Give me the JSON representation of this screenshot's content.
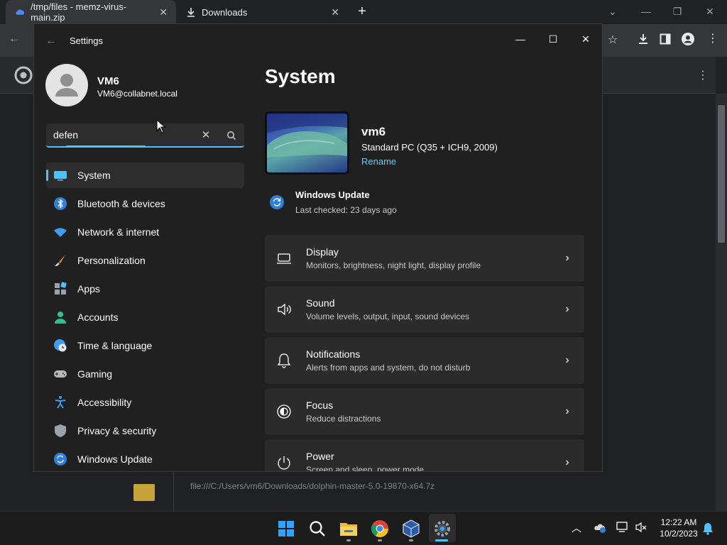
{
  "browser": {
    "tabs": [
      {
        "title": "/tmp/files - memz-virus-main.zip"
      },
      {
        "title": "Downloads"
      }
    ],
    "download_path": "file:///C:/Users/vm6/Downloads/dolphin-master-5.0-19870-x64.7z"
  },
  "settings": {
    "window_title": "Settings",
    "profile": {
      "name": "VM6",
      "email": "VM6@collabnet.local"
    },
    "search": {
      "value": "defen"
    },
    "nav": [
      {
        "label": "System",
        "icon": "monitor-icon",
        "active": true
      },
      {
        "label": "Bluetooth & devices",
        "icon": "bluetooth-icon"
      },
      {
        "label": "Network & internet",
        "icon": "wifi-icon"
      },
      {
        "label": "Personalization",
        "icon": "brush-icon"
      },
      {
        "label": "Apps",
        "icon": "apps-icon"
      },
      {
        "label": "Accounts",
        "icon": "person-icon"
      },
      {
        "label": "Time & language",
        "icon": "globe-clock-icon"
      },
      {
        "label": "Gaming",
        "icon": "gamepad-icon"
      },
      {
        "label": "Accessibility",
        "icon": "accessibility-icon"
      },
      {
        "label": "Privacy & security",
        "icon": "shield-icon"
      },
      {
        "label": "Windows Update",
        "icon": "update-icon"
      }
    ],
    "main": {
      "title": "System",
      "pc": {
        "name": "vm6",
        "model": "Standard PC (Q35 + ICH9, 2009)",
        "rename": "Rename"
      },
      "windows_update": {
        "title": "Windows Update",
        "subtitle": "Last checked: 23 days ago"
      },
      "cards": [
        {
          "title": "Display",
          "subtitle": "Monitors, brightness, night light, display profile",
          "icon": "laptop-icon"
        },
        {
          "title": "Sound",
          "subtitle": "Volume levels, output, input, sound devices",
          "icon": "speaker-icon"
        },
        {
          "title": "Notifications",
          "subtitle": "Alerts from apps and system, do not disturb",
          "icon": "bell-icon"
        },
        {
          "title": "Focus",
          "subtitle": "Reduce distractions",
          "icon": "focus-icon"
        },
        {
          "title": "Power",
          "subtitle": "Screen and sleep, power mode",
          "icon": "power-icon"
        }
      ]
    }
  },
  "taskbar": {
    "clock": {
      "time": "12:22 AM",
      "date": "10/2/2023"
    }
  },
  "colors": {
    "accent": "#4cc2ff",
    "link": "#60cdff",
    "window_bg": "#202020",
    "card_bg": "#2b2b2b"
  }
}
